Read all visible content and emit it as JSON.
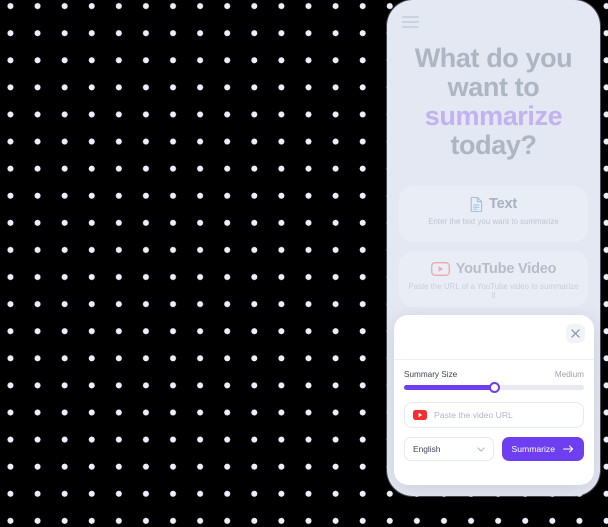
{
  "background": {
    "color": "#000000",
    "pattern": "dot-grid",
    "dot_color": "#eceffb"
  },
  "phone": {
    "background": "#e3e8f2",
    "menu_icon": "hamburger-icon",
    "headline": {
      "line1": "What do you",
      "line2": "want to",
      "accent": "summarize",
      "line4": "today?",
      "accent_color": "#c2b2ef",
      "text_color": "#aeb5c3"
    },
    "options": [
      {
        "icon": "document-icon",
        "title": "Text",
        "subtitle": "Enter the text you want to summarize"
      },
      {
        "icon": "youtube-icon",
        "title": "YouTube Video",
        "subtitle": "Paste the URL of a YouTube video to summarize it"
      }
    ]
  },
  "sheet": {
    "close_icon": "close-icon",
    "slider": {
      "label": "Summary Size",
      "value_label": "Medium",
      "percent": 50,
      "fill_color": "#6d3ff0",
      "track_color": "#e7eaf1"
    },
    "url_input": {
      "icon": "youtube-icon",
      "placeholder": "Paste the video URL",
      "value": ""
    },
    "language": {
      "selected": "English",
      "chevron_icon": "chevron-down-icon"
    },
    "submit": {
      "label": "Summarize",
      "icon": "arrow-right-icon",
      "color": "#6d3ff0"
    }
  }
}
